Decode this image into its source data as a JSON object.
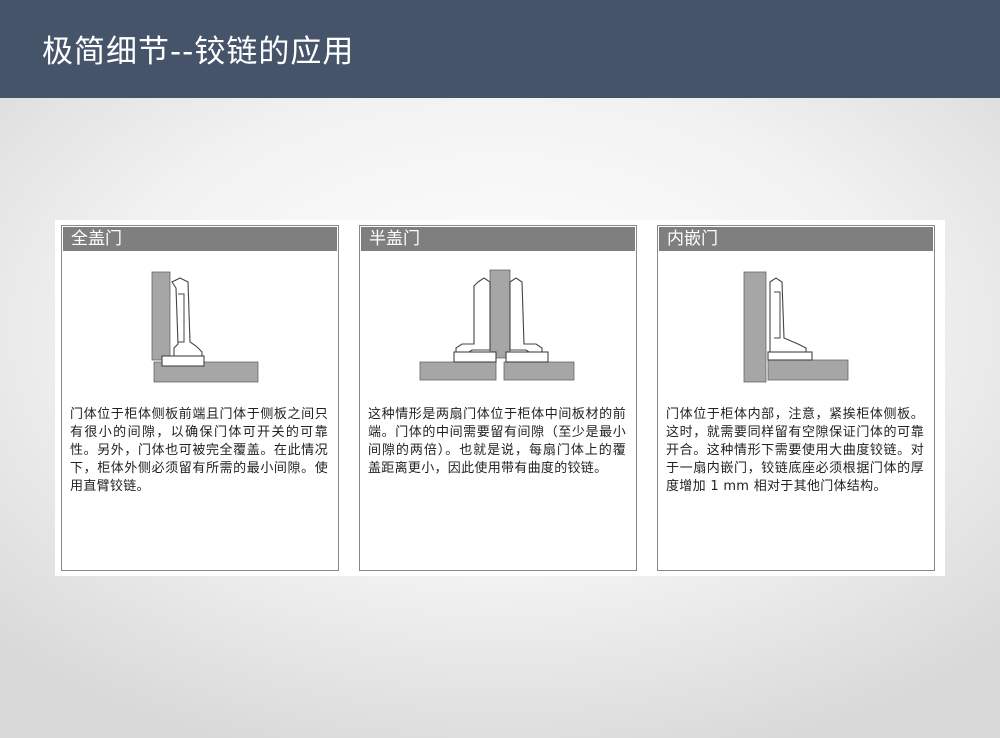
{
  "title": "极简细节--铰链的应用",
  "panels": [
    {
      "heading": "全盖门",
      "text": "门体位于柜体侧板前端且门体于侧板之间只有很小的间隙，以确保门体可开关的可靠性。另外，门体也可被完全覆盖。在此情况下，柜体外侧必须留有所需的最小间隙。使用直臂铰链。"
    },
    {
      "heading": "半盖门",
      "text": "这种情形是两扇门体位于柜体中间板材的前端。门体的中间需要留有间隙（至少是最小间隙的两倍）。也就是说，每扇门体上的覆盖距离更小，因此使用带有曲度的铰链。"
    },
    {
      "heading": "内嵌门",
      "text": "门体位于柜体内部，注意，紧挨柜体侧板。这时，就需要同样留有空隙保证门体的可靠开合。这种情形下需要使用大曲度铰链。对于一扇内嵌门，铰链底座必须根据门体的厚度增加 1 mm 相对于其他门体结构。"
    }
  ],
  "colors": {
    "header_bg": "#46546a",
    "panel_header_bg": "#7f7f7f",
    "board_fill": "#a6a6a6"
  }
}
